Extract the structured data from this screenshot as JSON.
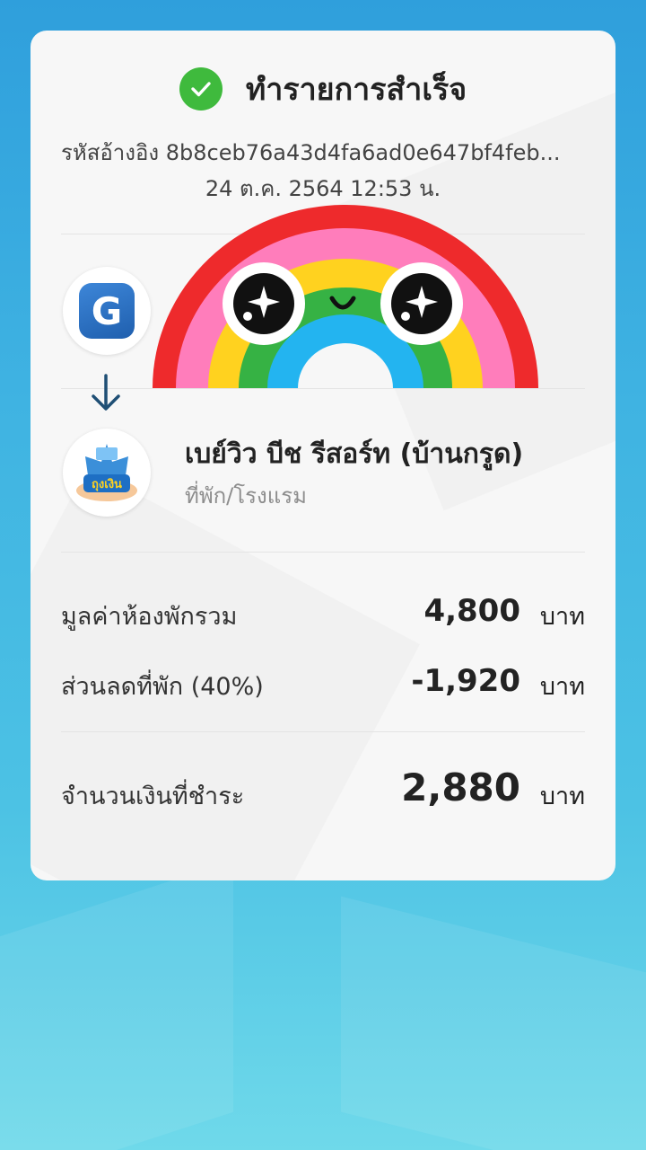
{
  "header": {
    "title": "ทำรายการสำเร็จ",
    "status_icon": "check-icon",
    "reference": "รหัสอ้างอิง 8b8ceb76a43d4fa6ad0e647bf4feb...",
    "datetime": "24 ต.ค. 2564 12:53 น."
  },
  "source": {
    "logo_letter": "G",
    "logo_icon": "gwallet-logo"
  },
  "merchant": {
    "logo_text": "ถุงเงิน",
    "name": "เบย์วิว บีช รีสอร์ท (บ้านกรูด)",
    "type": "ที่พัก/โรงแรม"
  },
  "summary": {
    "room_total_label": "มูลค่าห้องพักรวม",
    "room_total_amount": "4,800",
    "discount_label": "ส่วนลดที่พัก (40%)",
    "discount_amount": "-1,920",
    "paid_label": "จำนวนเงินที่ชำระ",
    "paid_amount": "2,880",
    "currency": "บาท"
  },
  "colors": {
    "success": "#3fba3d",
    "rainbow": [
      "#ee2a2c",
      "#ff7dbb",
      "#ffd21f",
      "#36b244",
      "#23b4f0"
    ]
  }
}
